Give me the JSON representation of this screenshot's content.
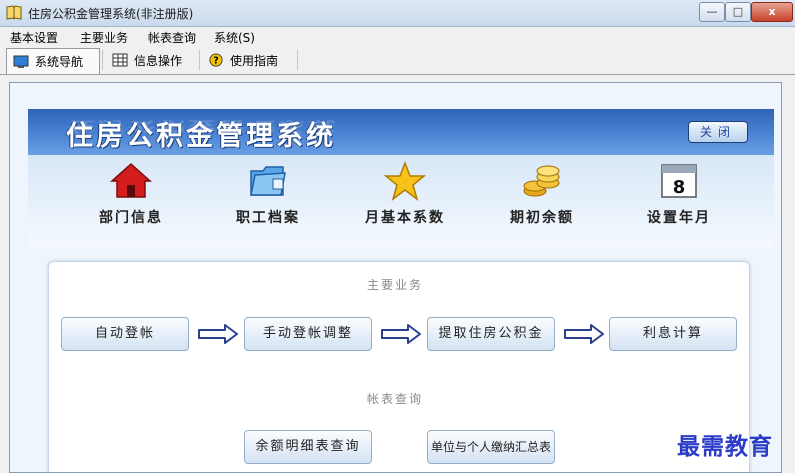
{
  "window": {
    "title": "住房公积金管理系统(非注册版)",
    "controls": {
      "minimize": "—",
      "maximize": "□",
      "close": "x"
    }
  },
  "menubar": [
    "基本设置",
    "主要业务",
    "帐表查询",
    "系统(S)"
  ],
  "tabs": [
    {
      "label": "系统导航",
      "icon": "monitor-icon",
      "active": true
    },
    {
      "label": "信息操作",
      "icon": "grid-icon",
      "active": false
    },
    {
      "label": "使用指南",
      "icon": "help-icon",
      "active": false
    }
  ],
  "header": {
    "title": "住房公积金管理系统",
    "close_label": "关闭"
  },
  "quick_access": [
    {
      "label": "部门信息",
      "icon": "house-icon"
    },
    {
      "label": "职工档案",
      "icon": "folder-icon"
    },
    {
      "label": "月基本系数",
      "icon": "star-icon"
    },
    {
      "label": "期初余额",
      "icon": "coins-icon"
    },
    {
      "label": "设置年月",
      "icon": "calendar-icon",
      "calendar_day": "8"
    }
  ],
  "main_business": {
    "title": "主要业务",
    "steps": [
      "自动登帐",
      "手动登帐调整",
      "提取住房公积金",
      "利息计算"
    ]
  },
  "report_query": {
    "title": "帐表查询",
    "buttons": [
      "余额明细表查询",
      "单位与个人缴纳汇总表"
    ]
  },
  "watermark": "最需教育",
  "colors": {
    "header_blue": "#3a6fc4",
    "accent_text": "#2d3cc8"
  }
}
